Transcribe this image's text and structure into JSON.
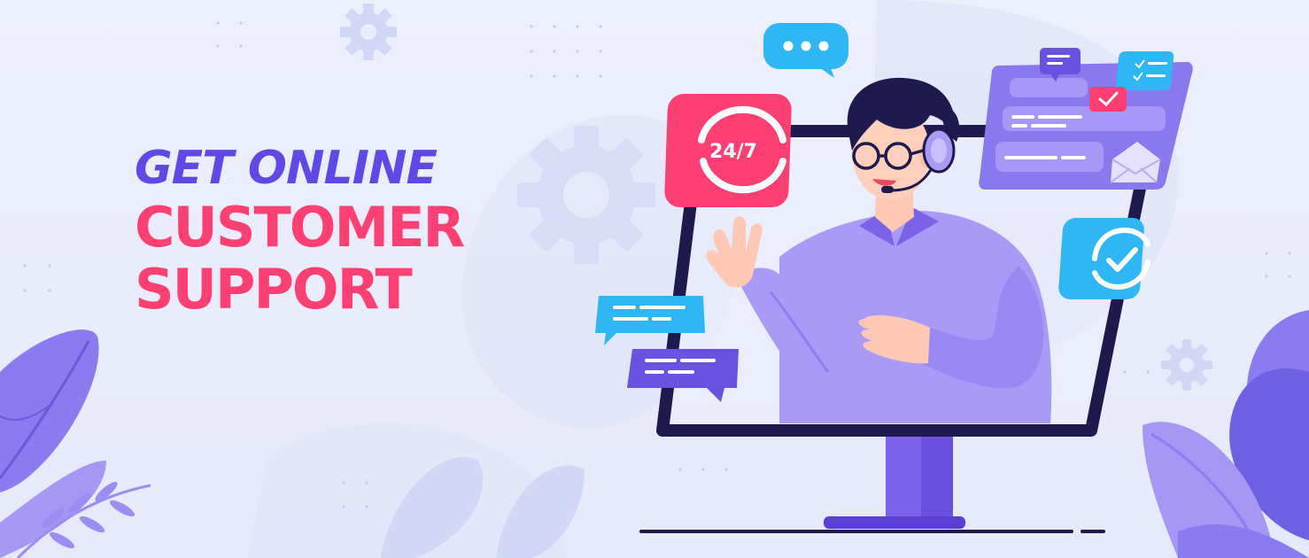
{
  "headline": {
    "line1": "GET ONLINE",
    "line2": "CUSTOMER",
    "line3": "SUPPORT"
  },
  "badge_24_7": {
    "label": "24/7"
  },
  "colors": {
    "background": "#e9ecfb",
    "headline_purple": "#6247e8",
    "headline_pink": "#fe3f73",
    "monitor_frame": "#1f1a4d",
    "sweater": "#a99af5",
    "bubble_blue": "#2fb6f5",
    "bubble_purple": "#6a52e0",
    "leaf": "#8a7cf0"
  },
  "icons": [
    "gear-icon",
    "chat-bubble-icon",
    "24-7-icon",
    "check-circle-icon",
    "envelope-icon",
    "checklist-icon",
    "headset-icon",
    "leaf-icon"
  ]
}
